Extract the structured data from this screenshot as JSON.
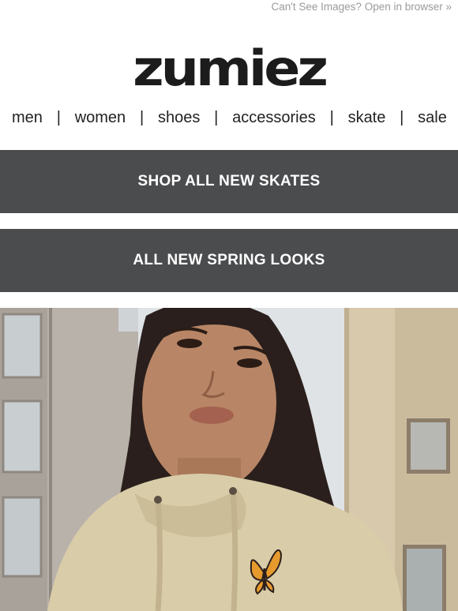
{
  "header": {
    "preheader_link": "Can't See Images? Open in browser »"
  },
  "brand": {
    "logo_text": "zumiez",
    "logo_color": "#1c1c1c"
  },
  "nav": {
    "items": [
      {
        "label": "men"
      },
      {
        "label": "women"
      },
      {
        "label": "shoes"
      },
      {
        "label": "accessories"
      },
      {
        "label": "skate"
      },
      {
        "label": "sale"
      }
    ],
    "separator": "|"
  },
  "buttons": {
    "shop_skates": "SHOP ALL NEW SKATES",
    "spring_looks": "ALL NEW SPRING LOOKS",
    "button_color": "#4b4c4e"
  },
  "hero": {
    "image_icon": "hero-photo-woman-hoodie"
  }
}
